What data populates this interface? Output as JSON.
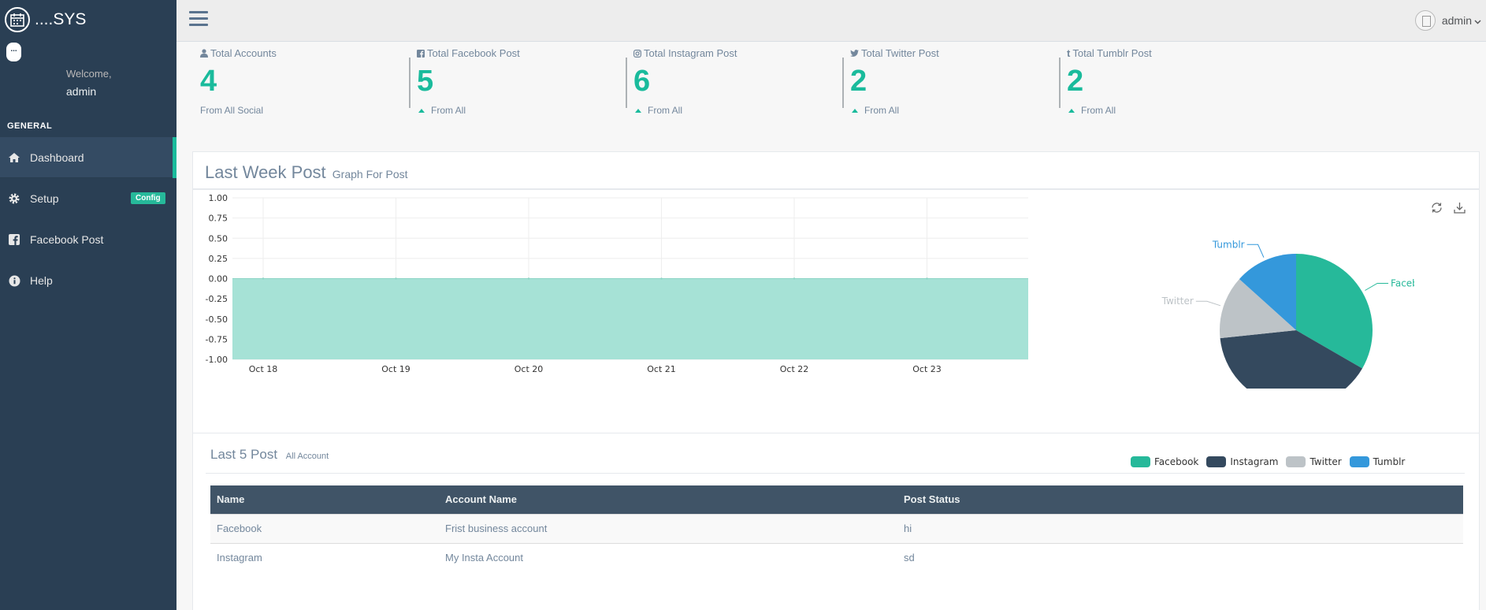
{
  "app": {
    "title": "....SYS"
  },
  "sidebar": {
    "welcome": "Welcome,",
    "user": "admin",
    "section": "GENERAL",
    "items": [
      {
        "label": "Dashboard",
        "icon": "home-icon",
        "active": true
      },
      {
        "label": "Setup",
        "icon": "gear-icon",
        "badge": "Config"
      },
      {
        "label": "Facebook Post",
        "icon": "facebook-icon"
      },
      {
        "label": "Help",
        "icon": "info-icon"
      }
    ]
  },
  "topbar": {
    "user": "admin"
  },
  "tiles": [
    {
      "title": "Total Accounts",
      "icon": "user-icon",
      "count": "4",
      "sub": "From All Social"
    },
    {
      "title": "Total Facebook Post",
      "icon": "facebook-icon",
      "count": "5",
      "sub": "From All"
    },
    {
      "title": "Total Instagram Post",
      "icon": "instagram-icon",
      "count": "6",
      "sub": "From All"
    },
    {
      "title": "Total Twitter Post",
      "icon": "twitter-icon",
      "count": "2",
      "sub": "From All"
    },
    {
      "title": "Total Tumblr Post",
      "icon": "tumblr-icon",
      "count": "2",
      "sub": "From All"
    }
  ],
  "panel": {
    "title": "Last Week Post",
    "subtitle": "Graph For Post"
  },
  "chart_data": [
    {
      "type": "area",
      "x": [
        "Oct 18",
        "Oct 19",
        "Oct 20",
        "Oct 21",
        "Oct 22",
        "Oct 23"
      ],
      "series": [
        {
          "values": [
            0,
            0,
            0,
            0,
            0,
            0
          ],
          "color": "#A6E2D6"
        }
      ],
      "ylim": [
        -1,
        1
      ],
      "yticks": [
        "1.00",
        "0.75",
        "0.50",
        "0.25",
        "0.00",
        "-0.25",
        "-0.50",
        "-0.75",
        "-1.00"
      ],
      "grid": true
    },
    {
      "type": "pie",
      "labels": [
        "Facebook",
        "Instagram",
        "Twitter",
        "Tumblr"
      ],
      "values": [
        5,
        6,
        2,
        2
      ],
      "colors": [
        "#26B99A",
        "#34495E",
        "#BDC3C7",
        "#3498DB"
      ],
      "legend": "bottom"
    }
  ],
  "table_section": {
    "title": "Last 5 Post",
    "subtitle": "All Account",
    "columns": [
      "Name",
      "Account Name",
      "Post Status"
    ],
    "rows": [
      [
        "Facebook",
        "Frist business account",
        "hi"
      ],
      [
        "Instagram",
        "My Insta Account",
        "sd"
      ]
    ]
  }
}
